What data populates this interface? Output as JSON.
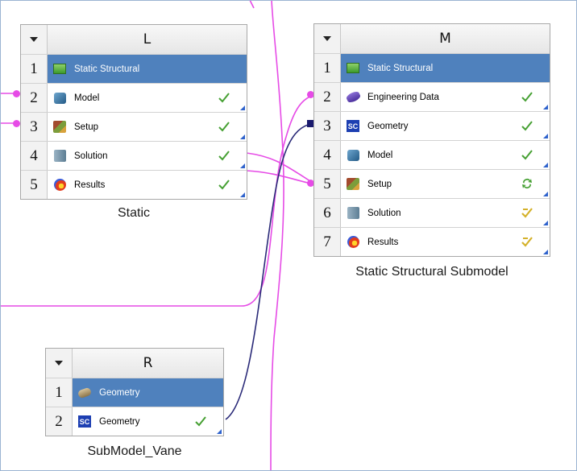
{
  "colors": {
    "header_selected": "#4f81bd",
    "link_magenta": "#e64be6",
    "link_navy": "#2a2a78",
    "check_green": "#46a033",
    "corner_blue": "#2e62cc"
  },
  "systems": {
    "L": {
      "letter": "L",
      "caption": "Static",
      "rows": [
        {
          "num": "1",
          "label": "Static Structural",
          "icon": "static-structural-icon",
          "state": ""
        },
        {
          "num": "2",
          "label": "Model",
          "icon": "model-icon",
          "state": "check-icon"
        },
        {
          "num": "3",
          "label": "Setup",
          "icon": "setup-icon",
          "state": "check-icon"
        },
        {
          "num": "4",
          "label": "Solution",
          "icon": "solution-icon",
          "state": "check-icon"
        },
        {
          "num": "5",
          "label": "Results",
          "icon": "results-icon",
          "state": "check-icon"
        }
      ]
    },
    "M": {
      "letter": "M",
      "caption": "Static Structural Submodel",
      "rows": [
        {
          "num": "1",
          "label": "Static Structural",
          "icon": "static-structural-icon",
          "state": ""
        },
        {
          "num": "2",
          "label": "Engineering Data",
          "icon": "engineering-data-icon",
          "state": "check-icon"
        },
        {
          "num": "3",
          "label": "Geometry",
          "icon": "spaceclaim-geometry-icon",
          "state": "check-icon"
        },
        {
          "num": "4",
          "label": "Model",
          "icon": "model-icon",
          "state": "check-icon"
        },
        {
          "num": "5",
          "label": "Setup",
          "icon": "setup-icon",
          "state": "refresh-icon"
        },
        {
          "num": "6",
          "label": "Solution",
          "icon": "solution-icon",
          "state": "update-required-icon"
        },
        {
          "num": "7",
          "label": "Results",
          "icon": "results-icon",
          "state": "update-required-icon"
        }
      ]
    },
    "R": {
      "letter": "R",
      "caption": "SubModel_Vane",
      "rows": [
        {
          "num": "1",
          "label": "Geometry",
          "icon": "geometry-icon",
          "state": ""
        },
        {
          "num": "2",
          "label": "Geometry",
          "icon": "spaceclaim-geometry-icon",
          "state": "check-icon"
        }
      ]
    }
  }
}
